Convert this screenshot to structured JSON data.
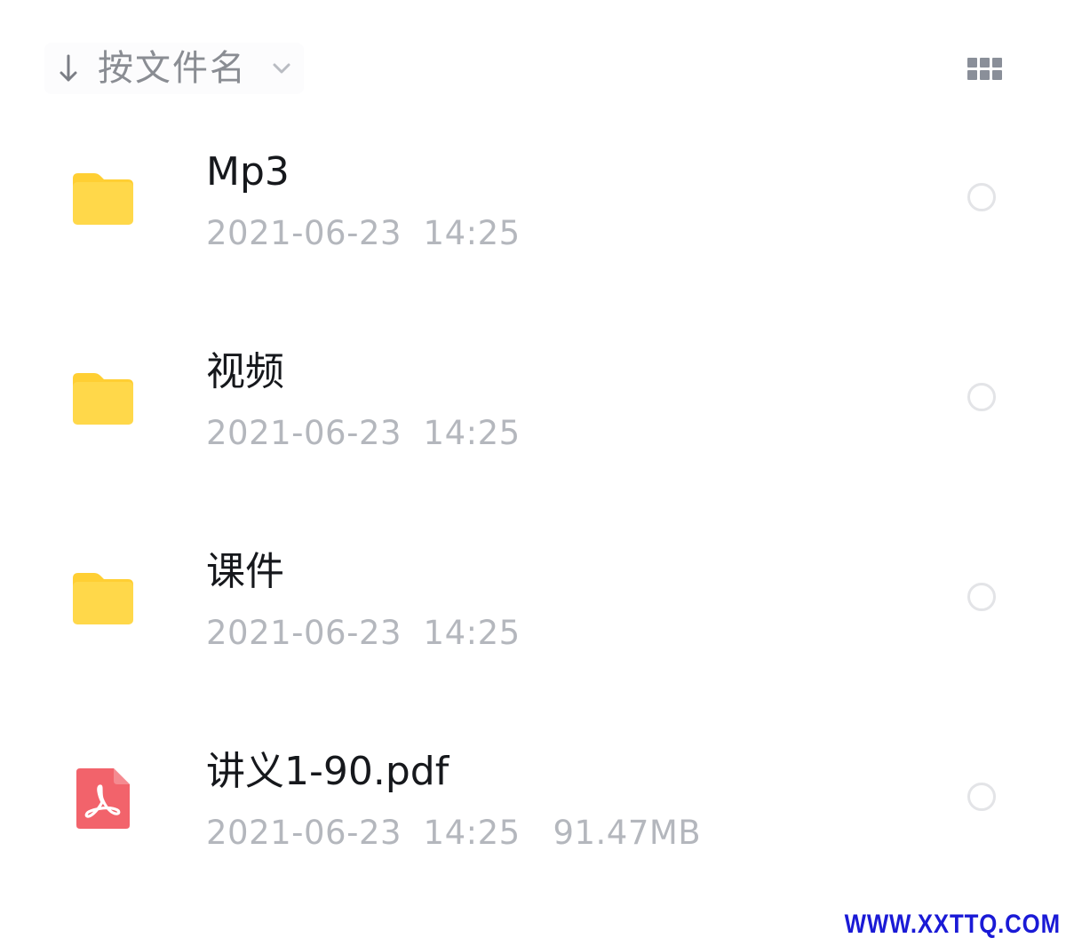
{
  "toolbar": {
    "sort_arrow_icon": "arrow-down-icon",
    "sort_label": "按文件名",
    "sort_chevron_icon": "chevron-down-icon",
    "view_toggle_icon": "grid-view-icon"
  },
  "files": [
    {
      "icon": "folder-icon",
      "name": "Mp3",
      "meta": "2021-06-23  14:25"
    },
    {
      "icon": "folder-icon",
      "name": "视频",
      "meta": "2021-06-23  14:25"
    },
    {
      "icon": "folder-icon",
      "name": "课件",
      "meta": "2021-06-23  14:25"
    },
    {
      "icon": "pdf-icon",
      "name": "讲义1-90.pdf",
      "meta": "2021-06-23  14:25   91.47MB"
    }
  ],
  "watermark": "WWW.XXTTQ.COM",
  "colors": {
    "folder": "#FFD84A",
    "folder_tab": "#FFCF33",
    "pdf": "#F2636B",
    "name_text": "#16181C",
    "meta_text": "#B4B7BD",
    "sort_text": "#8A8D93",
    "watermark": "#1A1AD6"
  }
}
